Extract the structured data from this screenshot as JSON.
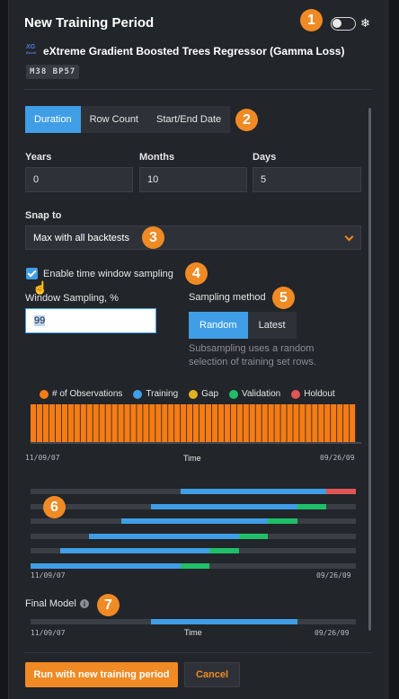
{
  "header": {
    "title": "New Training Period",
    "snowflake": "❄",
    "model_icon_top": "XG",
    "model_icon_bottom": "Boost",
    "model_name": "eXtreme Gradient Boosted Trees Regressor (Gamma Loss)",
    "badge": "M38 BP57",
    "toggle_on": false
  },
  "callouts": [
    "1",
    "2",
    "3",
    "4",
    "5",
    "6",
    "7"
  ],
  "tabs": [
    {
      "label": "Duration",
      "active": true
    },
    {
      "label": "Row Count",
      "active": false
    },
    {
      "label": "Start/End Date",
      "active": false
    }
  ],
  "duration": {
    "years_label": "Years",
    "years_value": "0",
    "months_label": "Months",
    "months_value": "10",
    "days_label": "Days",
    "days_value": "5"
  },
  "snap": {
    "label": "Snap to",
    "value": "Max with all backtests"
  },
  "sampling": {
    "checkbox_label": "Enable time window sampling",
    "checked": true,
    "window_label": "Window Sampling, %",
    "window_value": "99",
    "method_label": "Sampling method",
    "method_options": [
      "Random",
      "Latest"
    ],
    "method_selected": "Random",
    "hint": "Subsampling uses a random selection of training set rows."
  },
  "chart_data": {
    "type": "bar",
    "legend": [
      {
        "name": "# of Observations",
        "color": "#f57c14"
      },
      {
        "name": "Training",
        "color": "#3f9ee5"
      },
      {
        "name": "Gap",
        "color": "#e0b21f"
      },
      {
        "name": "Validation",
        "color": "#1fbf6a"
      },
      {
        "name": "Holdout",
        "color": "#e05555"
      }
    ],
    "bar_count": 52,
    "x_start": "11/09/07",
    "x_end": "09/26/09",
    "xlabel": "Time"
  },
  "backtests": {
    "x_start": "11/09/07",
    "x_end": "09/26/09",
    "rows": [
      {
        "training": [
          0.46,
          0.91
        ],
        "validation": null,
        "holdout": [
          0.91,
          1.0
        ]
      },
      {
        "training": [
          0.37,
          0.82
        ],
        "validation": [
          0.82,
          0.91
        ],
        "holdout": null
      },
      {
        "training": [
          0.28,
          0.73
        ],
        "validation": [
          0.73,
          0.82
        ],
        "holdout": null
      },
      {
        "training": [
          0.18,
          0.64
        ],
        "validation": [
          0.64,
          0.73
        ],
        "holdout": null
      },
      {
        "training": [
          0.09,
          0.55
        ],
        "validation": [
          0.55,
          0.64
        ],
        "holdout": null
      },
      {
        "training": [
          0.0,
          0.46
        ],
        "validation": [
          0.46,
          0.55
        ],
        "holdout": null
      }
    ]
  },
  "final_model": {
    "label": "Final Model",
    "info": "i",
    "training": [
      0.37,
      0.82
    ],
    "x_start": "11/09/07",
    "x_end": "09/26/09",
    "xlabel": "Time"
  },
  "actions": {
    "run_label": "Run with new training period",
    "cancel_label": "Cancel"
  }
}
